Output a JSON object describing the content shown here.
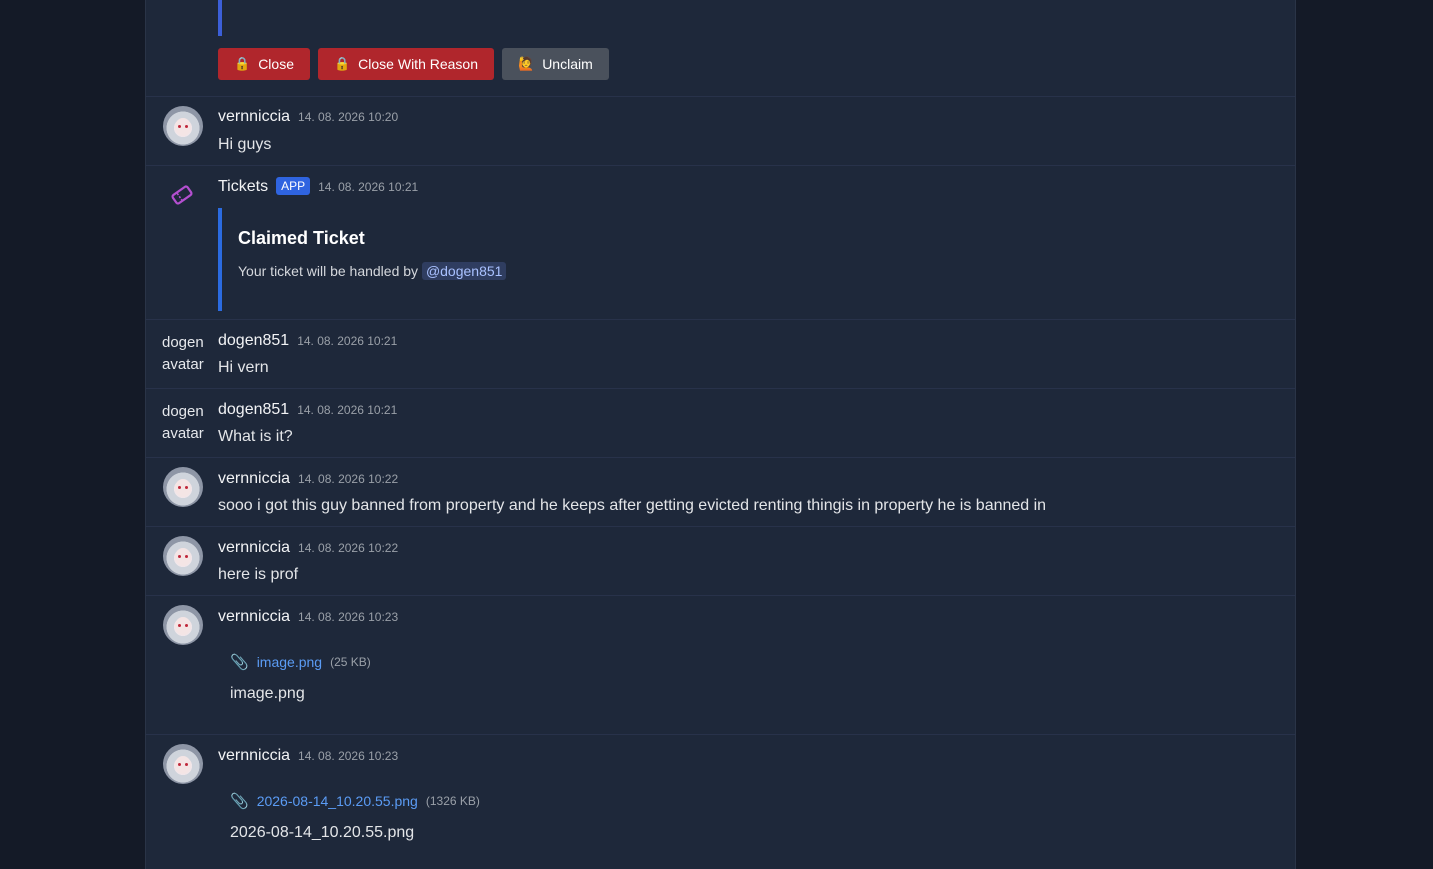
{
  "buttons": {
    "close": {
      "icon": "lock-icon",
      "label": "Close"
    },
    "close_reason": {
      "icon": "lock-icon",
      "label": "Close With Reason"
    },
    "unclaim": {
      "icon": "person-icon",
      "label": "Unclaim"
    }
  },
  "messages": [
    {
      "author": "vernniccia",
      "time": "14. 08. 2026 10:20",
      "text": "Hi guys"
    },
    {
      "author": "Tickets",
      "badge": "APP",
      "time": "14. 08. 2026 10:21",
      "embed": {
        "title": "Claimed Ticket",
        "desc": "Your ticket will be handled by",
        "mention": "@dogen851"
      }
    },
    {
      "author": "dogen851",
      "avatar_alt": "dogen851 avatar",
      "time": "14. 08. 2026 10:21",
      "text": "Hi vern"
    },
    {
      "author": "dogen851",
      "avatar_alt": "dogen851 avatar",
      "time": "14. 08. 2026 10:21",
      "text": "What is it?"
    },
    {
      "author": "vernniccia",
      "time": "14. 08. 2026 10:22",
      "text": "sooo i got this guy banned from property and he keeps after getting evicted renting thingis in property he is banned in"
    },
    {
      "author": "vernniccia",
      "time": "14. 08. 2026 10:22",
      "text": "here is prof"
    },
    {
      "author": "vernniccia",
      "time": "14. 08. 2026 10:23",
      "attachment": {
        "name": "image.png",
        "size": "(25 KB)",
        "caption": "image.png"
      }
    },
    {
      "author": "vernniccia",
      "time": "14. 08. 2026 10:23",
      "attachment": {
        "name": "2026-08-14_10.20.55.png",
        "size": "(1326 KB)",
        "caption": "2026-08-14_10.20.55.png"
      }
    }
  ]
}
